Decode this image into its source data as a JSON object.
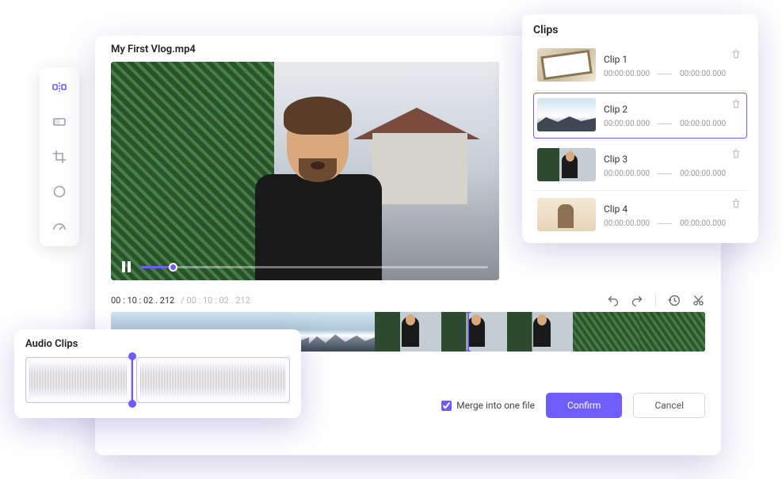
{
  "file_title": "My First Vlog.mp4",
  "playback": {
    "current_time": "00 : 10 : 02 . 212",
    "total_time": "/ 00 : 10 : 02 . 212"
  },
  "merge": {
    "label": "Merge into one file",
    "checked": true
  },
  "buttons": {
    "confirm": "Confirm",
    "cancel": "Cancel"
  },
  "clips_panel": {
    "title": "Clips",
    "items": [
      {
        "name": "Clip 1",
        "start": "00:00:00.000",
        "end": "00:00:00.000"
      },
      {
        "name": "Clip 2",
        "start": "00:00:00.000",
        "end": "00:00:00.000"
      },
      {
        "name": "Clip 3",
        "start": "00:00:00.000",
        "end": "00:00:00.000"
      },
      {
        "name": "Clip 4",
        "start": "00:00:00.000",
        "end": "00:00:00.000"
      }
    ]
  },
  "audio_panel": {
    "title": "Audio Clips"
  },
  "toolbar_icons": [
    "split-icon",
    "ratio-icon",
    "crop-icon",
    "circle-icon",
    "speed-icon"
  ],
  "timeline_icons": [
    "undo-icon",
    "redo-icon",
    "history-icon",
    "cut-icon"
  ]
}
